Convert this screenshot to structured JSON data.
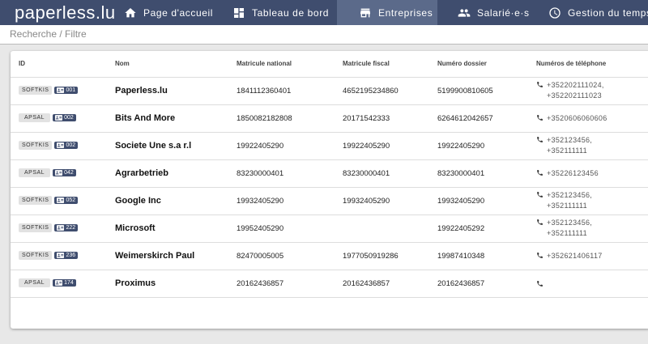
{
  "brand": "paperless.lu",
  "nav": {
    "home": "Page d'accueil",
    "dashboard": "Tableau de bord",
    "companies": "Entreprises",
    "employees": "Salarié·e·s",
    "time": "Gestion du temps"
  },
  "search": {
    "placeholder": "Recherche / Filtre"
  },
  "table": {
    "headers": [
      "ID",
      "Nom",
      "Matricule national",
      "Matricule fiscal",
      "Numéro dossier",
      "Numéros de téléphone"
    ],
    "rows": [
      {
        "org": "SOFTKIS",
        "num": "001",
        "name": "Paperless.lu",
        "national": "1841112360401",
        "fiscal": "4652195234860",
        "dossier": "5199900810605",
        "phones": [
          "+352202111024,",
          "+352202111023"
        ]
      },
      {
        "org": "APSAL",
        "num": "002",
        "name": "Bits And More",
        "national": "1850082182808",
        "fiscal": "20171542333",
        "dossier": "6264612042657",
        "phones": [
          "+3520606060606"
        ]
      },
      {
        "org": "SOFTKIS",
        "num": "002",
        "name": "Societe Une s.a r.l",
        "national": "19922405290",
        "fiscal": "19922405290",
        "dossier": "19922405290",
        "phones": [
          "+352123456,",
          "+352111111"
        ]
      },
      {
        "org": "APSAL",
        "num": "042",
        "name": "Agrarbetrieb",
        "national": "83230000401",
        "fiscal": "83230000401",
        "dossier": "83230000401",
        "phones": [
          "+35226123456"
        ]
      },
      {
        "org": "SOFTKIS",
        "num": "052",
        "name": "Google Inc",
        "national": "19932405290",
        "fiscal": "19932405290",
        "dossier": "19932405290",
        "phones": [
          "+352123456,",
          "+352111111"
        ]
      },
      {
        "org": "SOFTKIS",
        "num": "222",
        "name": "Microsoft",
        "national": "19952405290",
        "fiscal": "",
        "dossier": "19922405292",
        "phones": [
          "+352123456,",
          "+352111111"
        ]
      },
      {
        "org": "SOFTKIS",
        "num": "236",
        "name": "Weimerskirch Paul",
        "national": "82470005005",
        "fiscal": "1977050919286",
        "dossier": "19987410348",
        "phones": [
          "+352621406117"
        ]
      },
      {
        "org": "APSAL",
        "num": "174",
        "name": "Proximus",
        "national": "20162436857",
        "fiscal": "20162436857",
        "dossier": "20162436857",
        "phones": []
      }
    ]
  },
  "icons": {
    "home": "home-icon",
    "dashboard": "dashboard-icon",
    "companies": "store-icon",
    "employees": "people-icon",
    "time": "clock-icon",
    "badge": "id-card-icon",
    "phone": "phone-icon"
  },
  "colors": {
    "nav_bg": "#3f4d6e",
    "nav_active": "#5b6a8a",
    "badge_bg": "#3f4d6e",
    "tag_bg": "#e2e2e2"
  }
}
